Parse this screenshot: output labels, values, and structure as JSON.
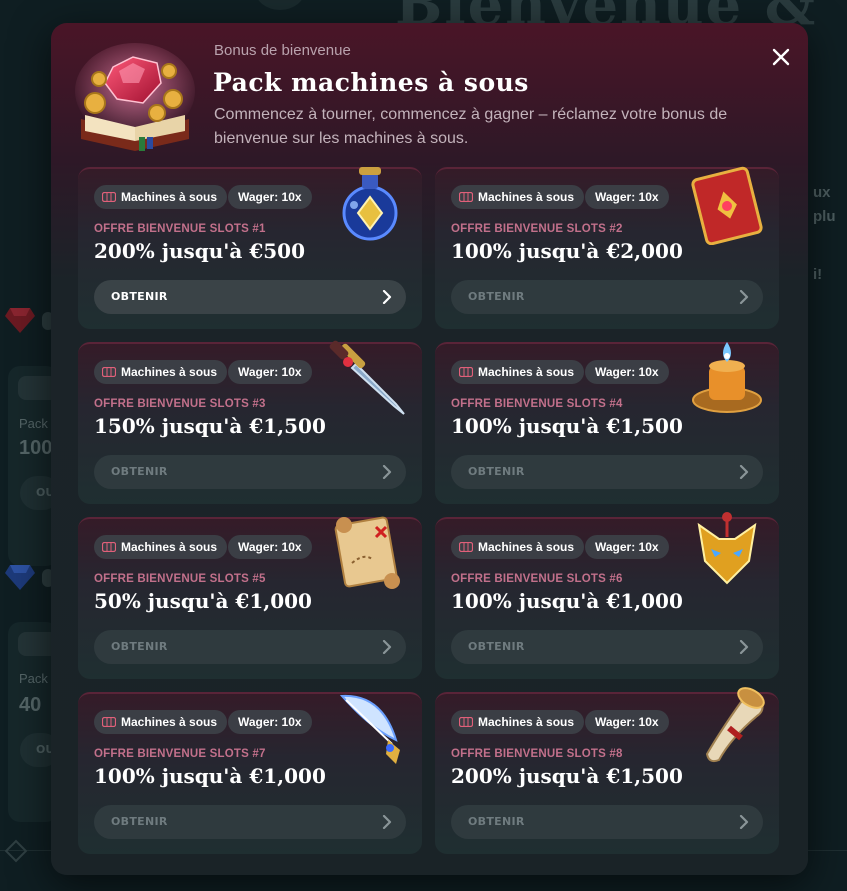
{
  "background": {
    "hero_title": "Bienvenue &",
    "right_snippets": [
      "ux",
      "plu",
      "i!"
    ],
    "left_cards": [
      {
        "pack_label": "Pack",
        "amount": "100",
        "btn": "OU"
      },
      {
        "pack_label": "Pack",
        "amount": "40",
        "btn": "OU"
      }
    ]
  },
  "modal": {
    "eyebrow": "Bonus de bienvenue",
    "title": "Pack machines à sous",
    "description": "Commencez à tourner, commencez à gagner – réclamez votre bonus de bienvenue sur les machines à sous.",
    "close_icon": "close-icon",
    "offers": [
      {
        "category": "Machines à sous",
        "wager": "Wager: 10x",
        "label": "OFFRE BIENVENUE SLOTS #1",
        "value": "200% jusqu'à €500",
        "button": "OBTENIR",
        "active": true,
        "art": "potion-icon"
      },
      {
        "category": "Machines à sous",
        "wager": "Wager: 10x",
        "label": "OFFRE BIENVENUE SLOTS #2",
        "value": "100% jusqu'à €2,000",
        "button": "OBTENIR",
        "active": false,
        "art": "spellbook-icon"
      },
      {
        "category": "Machines à sous",
        "wager": "Wager: 10x",
        "label": "OFFRE BIENVENUE SLOTS #3",
        "value": "150% jusqu'à €1,500",
        "button": "OBTENIR",
        "active": false,
        "art": "dagger-icon"
      },
      {
        "category": "Machines à sous",
        "wager": "Wager: 10x",
        "label": "OFFRE BIENVENUE SLOTS #4",
        "value": "100% jusqu'à €1,500",
        "button": "OBTENIR",
        "active": false,
        "art": "candle-icon"
      },
      {
        "category": "Machines à sous",
        "wager": "Wager: 10x",
        "label": "OFFRE BIENVENUE SLOTS #5",
        "value": "50% jusqu'à €1,000",
        "button": "OBTENIR",
        "active": false,
        "art": "treasure-map-icon"
      },
      {
        "category": "Machines à sous",
        "wager": "Wager: 10x",
        "label": "OFFRE BIENVENUE SLOTS #6",
        "value": "100% jusqu'à €1,000",
        "button": "OBTENIR",
        "active": false,
        "art": "fox-mask-icon"
      },
      {
        "category": "Machines à sous",
        "wager": "Wager: 10x",
        "label": "OFFRE BIENVENUE SLOTS #7",
        "value": "100% jusqu'à €1,000",
        "button": "OBTENIR",
        "active": false,
        "art": "quill-icon"
      },
      {
        "category": "Machines à sous",
        "wager": "Wager: 10x",
        "label": "OFFRE BIENVENUE SLOTS #8",
        "value": "200% jusqu'à €1,500",
        "button": "OBTENIR",
        "active": false,
        "art": "horn-icon"
      }
    ]
  },
  "colors": {
    "accent_label": "#c2708b",
    "header_gradient": "#4a1527",
    "panel": "#1a2327"
  }
}
